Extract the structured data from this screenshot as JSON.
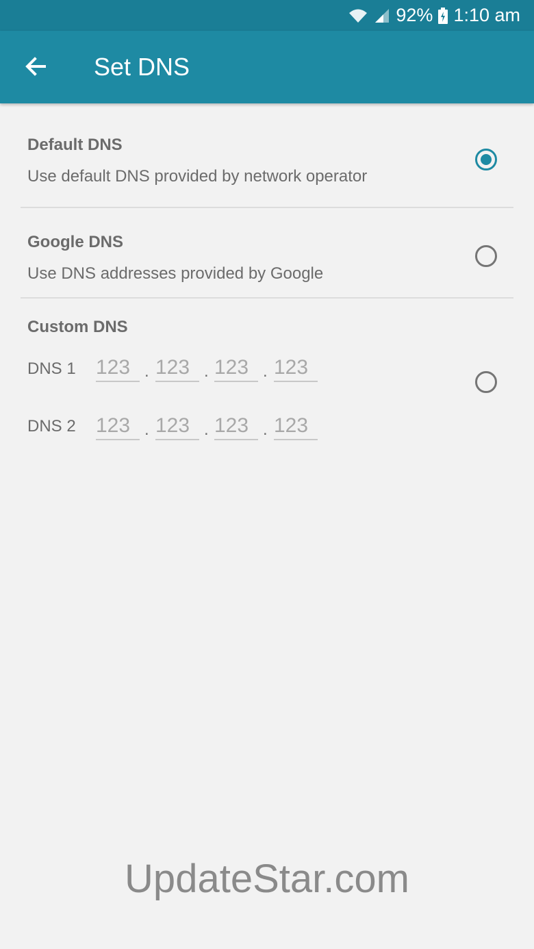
{
  "status_bar": {
    "battery": "92%",
    "time": "1:10 am",
    "icons": [
      "wifi-icon",
      "signal-icon",
      "battery-charging-icon"
    ]
  },
  "app_bar": {
    "title": "Set DNS",
    "back_icon": "arrow-left-icon",
    "color": "#1e8aa3"
  },
  "options": {
    "default": {
      "title": "Default DNS",
      "description": "Use default DNS provided by network operator",
      "selected": true
    },
    "google": {
      "title": "Google DNS",
      "description": "Use DNS addresses provided by Google",
      "selected": false
    },
    "custom": {
      "title": "Custom DNS",
      "selected": false,
      "dns1": {
        "label": "DNS 1",
        "placeholders": [
          "123",
          "123",
          "123",
          "123"
        ]
      },
      "dns2": {
        "label": "DNS 2",
        "placeholders": [
          "123",
          "123",
          "123",
          "123"
        ]
      },
      "separator": "."
    }
  },
  "watermark": "UpdateStar.com"
}
